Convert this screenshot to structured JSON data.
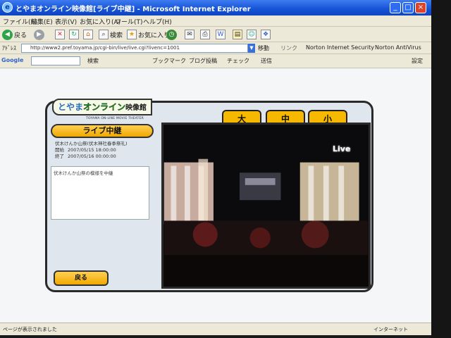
{
  "window": {
    "title": "とやまオンライン映像館[ライブ中継] - Microsoft Internet Explorer",
    "controls": [
      "_",
      "□",
      "×"
    ]
  },
  "menu": {
    "items": [
      "ファイル(F)",
      "編集(E)",
      "表示(V)",
      "お気に入り(A)",
      "ツール(T)",
      "ヘルプ(H)"
    ]
  },
  "toolbar": {
    "back_label": "戻る",
    "search_label": "検索",
    "favorites_label": "お気に入り"
  },
  "address": {
    "url": "http://www2.pref.toyama.jp/cgi-bin/live/live.cgi?livenc=1001",
    "go_label": "移動",
    "links_label": "リンク",
    "norton_label": "Norton Internet Security",
    "antivirus_label": "Norton AntiVirus"
  },
  "google_bar": {
    "logo": "Google",
    "search_button": "検索",
    "bookmarks": "ブックマーク",
    "blog": "ブログ投稿",
    "check": "チェック",
    "send": "送信",
    "settings": "設定"
  },
  "page": {
    "logo_prefix": "とやま",
    "logo_highlight": "オンライン",
    "logo_suffix": "映像館",
    "logo_sub": "TOYAMA ON-LINE MOVIE THEATER",
    "size_tabs": [
      "大",
      "中",
      "小"
    ],
    "banner": "ライブ中継",
    "event_title": "伏木けんか山祭(伏木神社春季祭礼)",
    "start_label": "開始",
    "start_value": "2007/05/15 18:00:00",
    "end_label": "終了",
    "end_value": "2007/05/16 00:00:00",
    "description": "伏木けんか山祭の模様を中継",
    "back_button": "戻る",
    "live_badge": "Live"
  },
  "status": {
    "text": "ページが表示されました",
    "zone": "インターネット"
  },
  "colors": {
    "accent": "#f7b800",
    "title_bar": "#1552d6",
    "video_bg": "#0a0a0a"
  }
}
